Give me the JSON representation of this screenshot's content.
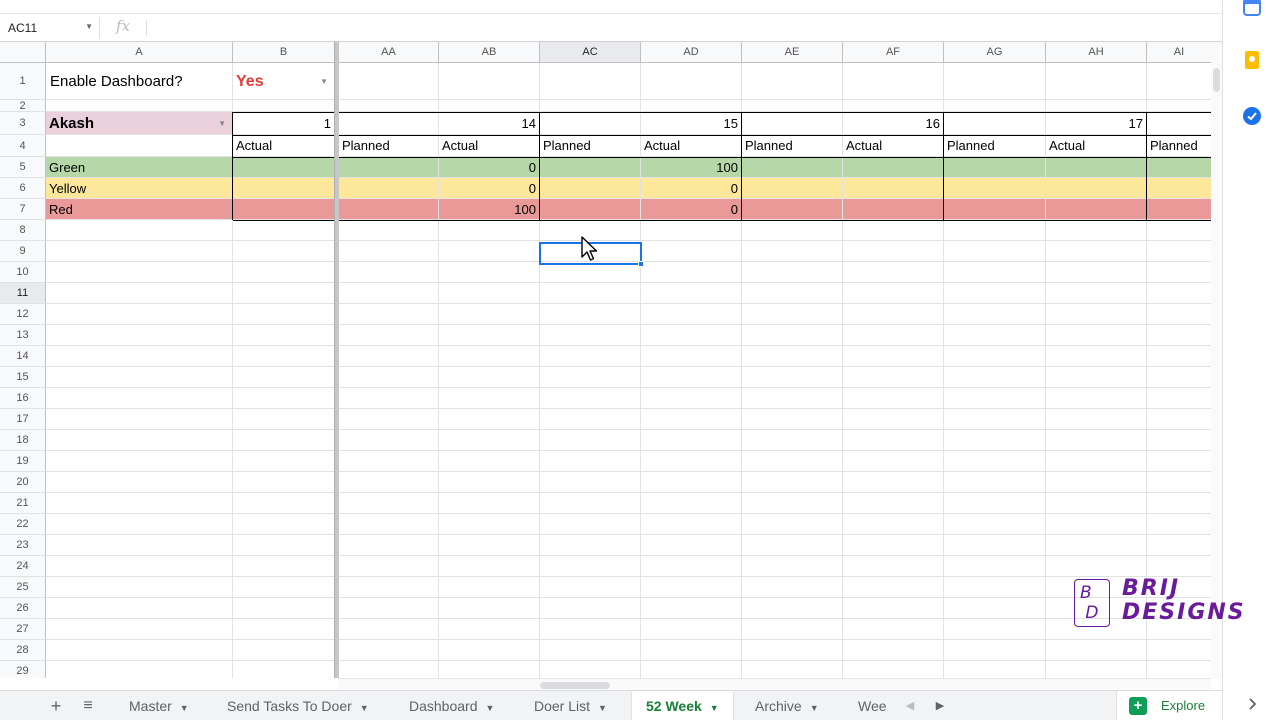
{
  "name_box": {
    "ref": "AC11"
  },
  "formula_bar": {
    "fx_label": "fx"
  },
  "columns": {
    "A": "A",
    "B": "B",
    "AA": "AA",
    "AB": "AB",
    "AC": "AC",
    "AD": "AD",
    "AE": "AE",
    "AF": "AF",
    "AG": "AG",
    "AH": "AH",
    "AI": "AI"
  },
  "rows": [
    "1",
    "2",
    "3",
    "4",
    "5",
    "6",
    "7",
    "8",
    "9",
    "10",
    "11",
    "12",
    "13",
    "14",
    "15",
    "16",
    "17",
    "18",
    "19",
    "20",
    "21",
    "22",
    "23",
    "24",
    "25",
    "26",
    "27",
    "28",
    "29"
  ],
  "cells": {
    "A1": "Enable Dashboard?",
    "B1": "Yes",
    "A3": "Akash",
    "B3": "1",
    "AB3": "14",
    "AD3": "15",
    "AF3": "16",
    "AH3": "17",
    "B4": "Actual",
    "AA4": "Planned",
    "AB4": "Actual",
    "AC4": "Planned",
    "AD4": "Actual",
    "AE4": "Planned",
    "AF4": "Actual",
    "AG4": "Planned",
    "AH4": "Actual",
    "AI4": "Planned",
    "A5": "Green",
    "AB5": "0",
    "AD5": "100",
    "A6": "Yellow",
    "AB6": "0",
    "AD6": "0",
    "A7": "Red",
    "AB7": "100",
    "AD7": "0"
  },
  "colors": {
    "green": "#b6d7a8",
    "yellow": "#fde79a",
    "red": "#ea9999",
    "pink": "#ead1dc",
    "yes_text": "#e53935",
    "selection": "#1a73e8",
    "active_tab": "#188038"
  },
  "sheet_tabs": [
    {
      "label": "Master"
    },
    {
      "label": "Send Tasks To Doer"
    },
    {
      "label": "Dashboard"
    },
    {
      "label": "Doer List"
    },
    {
      "label": "52 Week",
      "active": true
    },
    {
      "label": "Archive"
    },
    {
      "label": "Wee"
    }
  ],
  "explore": {
    "label": "Explore"
  },
  "watermark": {
    "mark": "B D",
    "text_line1": "BRIJ",
    "text_line2": "DESIGNS"
  },
  "icons": {
    "add_sheet": "plus-icon",
    "all_sheets": "menu-icon",
    "scroll_left": "chevron-left-icon",
    "scroll_right": "chevron-right-icon",
    "side_panel_expand": "chevron-right-icon"
  }
}
